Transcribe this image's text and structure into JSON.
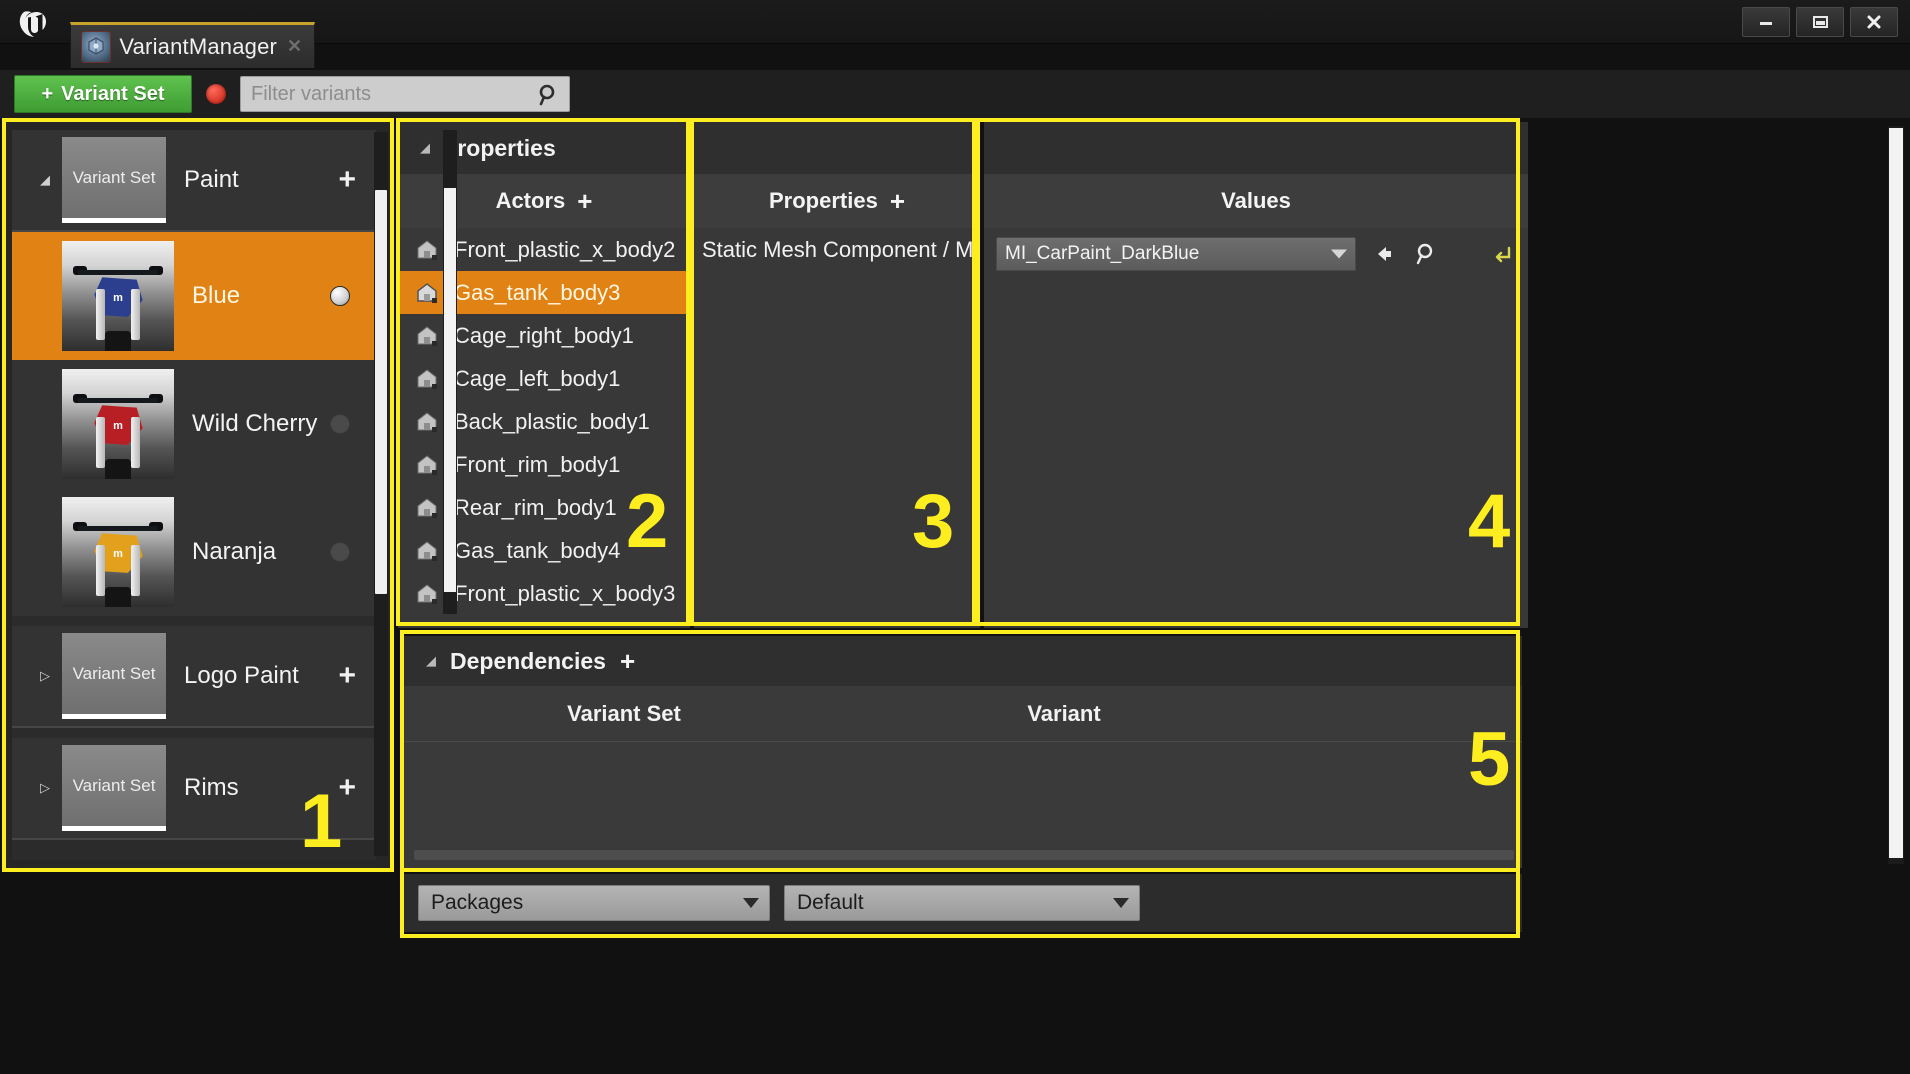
{
  "window": {
    "title": "VariantManager",
    "tab_label": "VariantManager",
    "tab_icon": "variant-manager-icon",
    "close_label": "✕",
    "minimize_label": "—",
    "maximize_label": "❐",
    "app_logo": "unreal-engine-logo"
  },
  "toolbar": {
    "add_variant_set_label": "Variant Set",
    "add_variant_set_plus": "+",
    "record_indicator": "record-dot",
    "filter_placeholder": "Filter variants",
    "filter_value": "",
    "search_icon": "search-icon"
  },
  "annotations": {
    "region1": "1",
    "region2": "2",
    "region3": "3",
    "region4": "4",
    "region5": "5",
    "highlight_color": "#ffee1f"
  },
  "left_panel": {
    "scrollbar": "vertical-scrollbar",
    "groups": [
      {
        "type": "variant_set",
        "name": "Paint",
        "thumb_label": "Variant Set",
        "expanded": true,
        "caret": "◢",
        "add_label": "+",
        "variants": [
          {
            "name": "Blue",
            "selected": true,
            "active": true,
            "thumb": "moto-blue",
            "thumb_color": "#2c3f8f"
          },
          {
            "name": "Wild Cherry",
            "selected": false,
            "active": false,
            "thumb": "moto-red",
            "thumb_color": "#b81f24"
          },
          {
            "name": "Naranja",
            "selected": false,
            "active": false,
            "thumb": "moto-orange",
            "thumb_color": "#e2a01c"
          }
        ]
      },
      {
        "type": "variant_set",
        "name": "Logo Paint",
        "thumb_label": "Variant Set",
        "expanded": false,
        "caret": "▷",
        "add_label": "+",
        "variants": []
      },
      {
        "type": "variant_set",
        "name": "Rims",
        "thumb_label": "Variant Set",
        "expanded": false,
        "caret": "▷",
        "add_label": "+",
        "variants": []
      }
    ]
  },
  "properties_panel": {
    "header_title": "Properties",
    "header_caret": "◢",
    "actors_column": {
      "title": "Actors",
      "add_label": "+",
      "rows": [
        {
          "name": "Front_plastic_x_body2",
          "icon": "actor-icon",
          "selected": false
        },
        {
          "name": "Gas_tank_body3",
          "icon": "actor-icon",
          "selected": true
        },
        {
          "name": "Cage_right_body1",
          "icon": "actor-icon",
          "selected": false
        },
        {
          "name": "Cage_left_body1",
          "icon": "actor-icon",
          "selected": false
        },
        {
          "name": "Back_plastic_body1",
          "icon": "actor-icon",
          "selected": false
        },
        {
          "name": "Front_rim_body1",
          "icon": "actor-icon",
          "selected": false
        },
        {
          "name": "Rear_rim_body1",
          "icon": "actor-icon",
          "selected": false
        },
        {
          "name": "Gas_tank_body4",
          "icon": "actor-icon",
          "selected": false
        },
        {
          "name": "Front_plastic_x_body3",
          "icon": "actor-icon",
          "selected": false
        }
      ]
    },
    "properties_column": {
      "title": "Properties",
      "add_label": "+",
      "rows": [
        {
          "name": "Static Mesh Component / Mat"
        }
      ]
    },
    "values_column": {
      "title": "Values",
      "rows": [
        {
          "combo_value": "MI_CarPaint_DarkBlue",
          "back_icon": "arrow-left-icon",
          "browse_icon": "search-icon",
          "reset_icon": "reset-arrow-icon"
        }
      ]
    }
  },
  "dependencies_panel": {
    "header_title": "Dependencies",
    "header_caret": "◢",
    "add_label": "+",
    "columns": [
      "Variant Set",
      "Variant"
    ],
    "rows": []
  },
  "bottom_bar": {
    "packages_value": "Packages",
    "default_value": "Default"
  }
}
